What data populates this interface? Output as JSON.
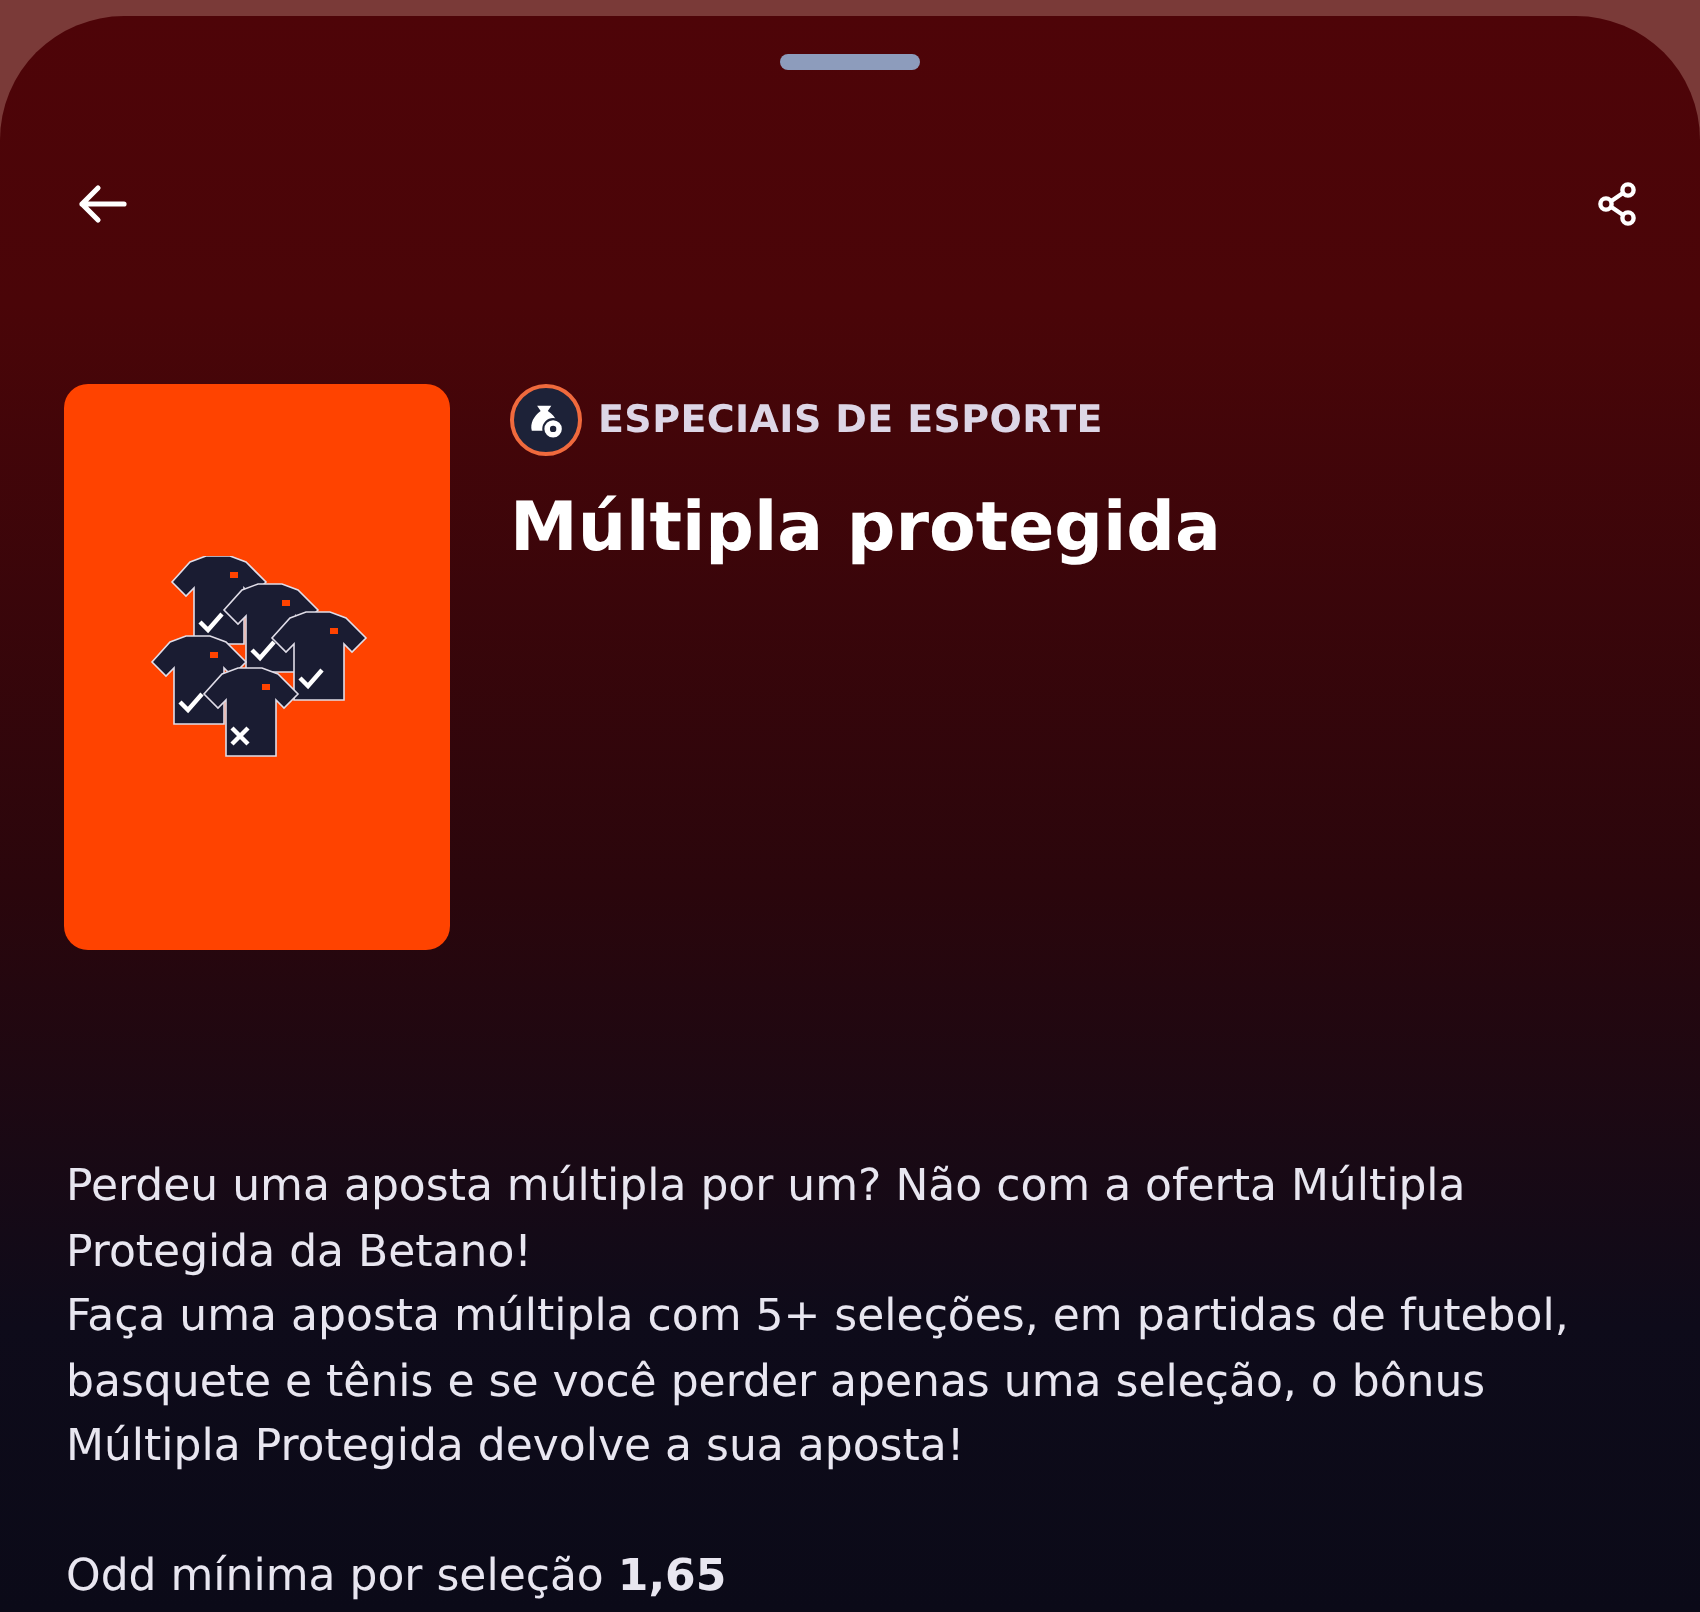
{
  "category": "ESPECIAIS DE ESPORTE",
  "title": "Múltipla protegida",
  "paragraphs": [
    "Perdeu uma aposta múltipla por um? Não com a oferta Múltipla Protegida da Betano!",
    "Faça uma aposta múltipla com 5+ seleções, em partidas de futebol, basquete e tênis e se você perder apenas uma seleção, o bônus Múltipla Protegida devolve a sua aposta!"
  ],
  "min_odd": "Odd mínima por seleção **1,65**"
}
